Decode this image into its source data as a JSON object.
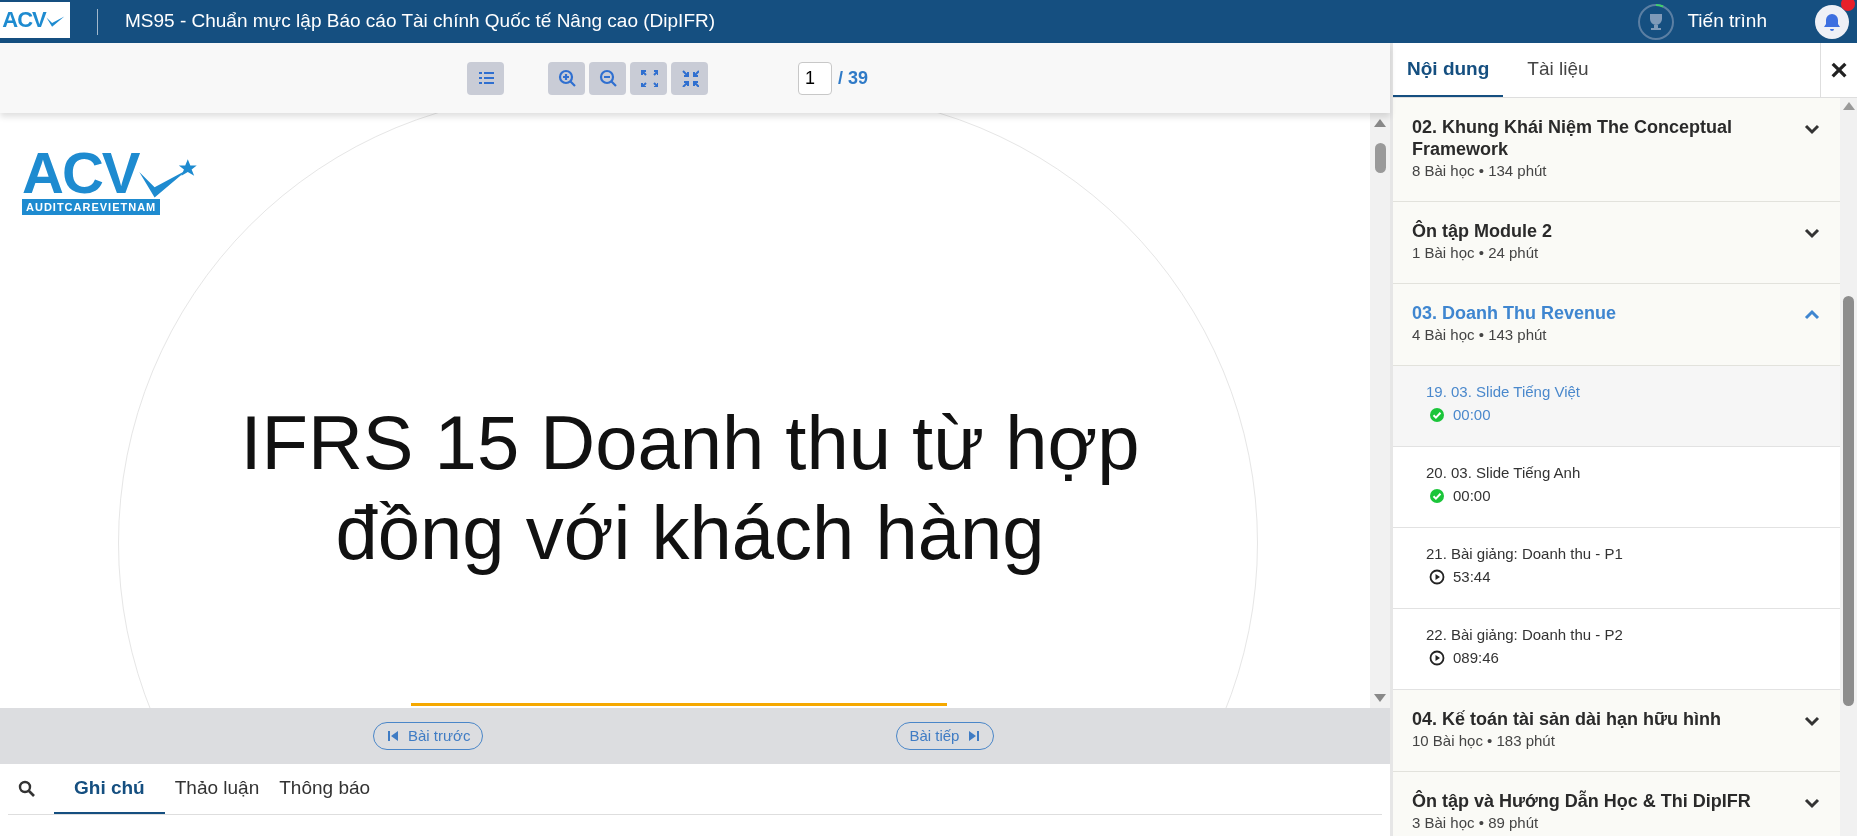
{
  "header": {
    "logo_text": "ACV",
    "title": "MS95 - Chuẩn mực lập Báo cáo Tài chính Quốc tế Nâng cao (DipIFR)",
    "progress_label": "Tiến trình"
  },
  "toolbar": {
    "page_value": "1",
    "page_total": "/ 39"
  },
  "slide": {
    "logo_text": "ACV",
    "logo_caption": "AUDITCAREVIETNAM",
    "title": "IFRS 15 Doanh thu từ hợp đồng với khách hàng"
  },
  "nav": {
    "prev": "Bài trước",
    "next": "Bài tiếp"
  },
  "bottom_tabs": [
    {
      "label": "Ghi chú",
      "selected": true
    },
    {
      "label": "Thảo luận",
      "selected": false
    },
    {
      "label": "Thông báo",
      "selected": false
    }
  ],
  "sidebar": {
    "tabs": [
      {
        "label": "Nội dung",
        "selected": true
      },
      {
        "label": "Tài liệu",
        "selected": false
      }
    ],
    "close": "×",
    "sections": [
      {
        "title": "02. Khung Khái Niệm The Conceptual Framework",
        "meta": "8 Bài học • 134 phút",
        "expanded": false
      },
      {
        "title": "Ôn tập Module 2",
        "meta": "1 Bài học • 24 phút",
        "expanded": false
      },
      {
        "title": "03. Doanh Thu Revenue",
        "meta": "4 Bài học • 143 phút",
        "expanded": true,
        "children": [
          {
            "title": "19. 03. Slide Tiếng Việt",
            "time": "00:00",
            "kind": "done",
            "selected": true
          },
          {
            "title": "20. 03. Slide Tiếng Anh",
            "time": "00:00",
            "kind": "done",
            "selected": false
          },
          {
            "title": "21. Bài giảng: Doanh thu - P1",
            "time": "53:44",
            "kind": "video",
            "selected": false
          },
          {
            "title": "22. Bài giảng: Doanh thu - P2",
            "time": "089:46",
            "kind": "video",
            "selected": false
          }
        ]
      },
      {
        "title": "04. Kế toán tài sản dài hạn hữu hình",
        "meta": "10 Bài học • 183 phút",
        "expanded": false
      },
      {
        "title": "Ôn tập và Hướng Dẫn Học & Thi DipIFR",
        "meta": "3 Bài học • 89 phút",
        "expanded": false
      }
    ]
  }
}
